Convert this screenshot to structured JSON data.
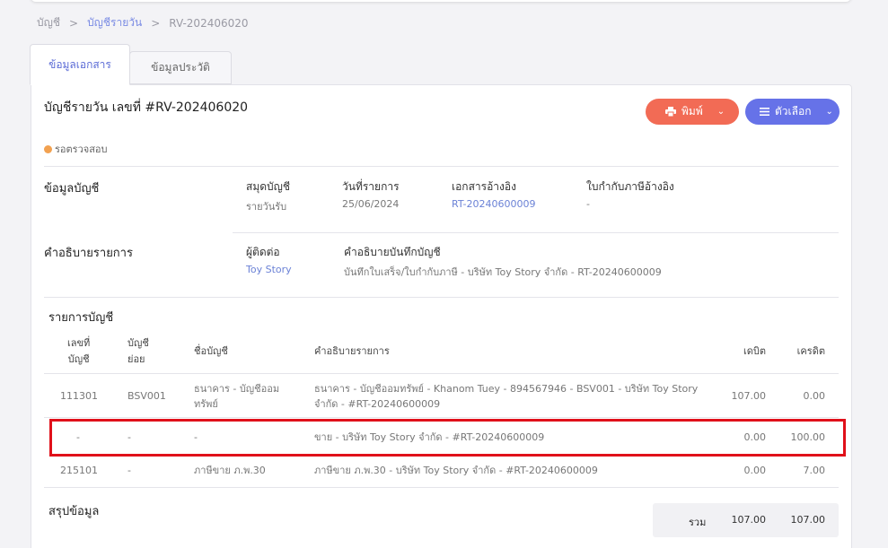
{
  "breadcrumb": {
    "item1": "บัญชี",
    "sep": ">",
    "item2": "บัญชีรายวัน",
    "item3": "RV-202406020"
  },
  "tabs": {
    "doc_info": "ข้อมูลเอกสาร",
    "history": "ข้อมูลประวัติ"
  },
  "doc": {
    "title": "บัญชีรายวัน เลขที่ #RV-202406020",
    "status": "รอตรวจสอบ",
    "status_color": "#f2a150"
  },
  "buttons": {
    "print": "พิมพ์",
    "options": "ตัวเลือก",
    "print_color": "#f26b55",
    "options_color": "#6672e8"
  },
  "account_info": {
    "label": "ข้อมูลบัญชี",
    "book_k": "สมุดบัญชี",
    "book_v": "รายวันรับ",
    "date_k": "วันที่รายการ",
    "date_v": "25/06/2024",
    "ref_k": "เอกสารอ้างอิง",
    "ref_v": "RT-20240600009",
    "tax_k": "ใบกำกับภาษีอ้างอิง",
    "tax_v": "-"
  },
  "description": {
    "label": "คำอธิบายรายการ",
    "contact_k": "ผู้ติดต่อ",
    "contact_v": "Toy Story",
    "note_k": "คำอธิบายบันทึกบัญชี",
    "note_v": "บันทึกใบเสร็จ/ใบกำกับภาษี - บริษัท Toy Story จำกัด - RT-20240600009"
  },
  "entries": {
    "title": "รายการบัญชี",
    "headers": {
      "no_1": "เลขที่",
      "no_2": "บัญชี",
      "sub_1": "บัญชี",
      "sub_2": "ย่อย",
      "name": "ชื่อบัญชี",
      "desc": "คำอธิบายรายการ",
      "debit": "เดบิต",
      "credit": "เครดิต"
    },
    "rows": [
      {
        "no": "111301",
        "sub": "BSV001",
        "name_1": "ธนาคาร - บัญชีออม",
        "name_2": "ทรัพย์",
        "desc_1": "ธนาคาร - บัญชีออมทรัพย์ - Khanom Tuey - 894567946 - BSV001 - บริษัท Toy Story",
        "desc_2": "จำกัด - #RT-20240600009",
        "debit": "107.00",
        "credit": "0.00"
      },
      {
        "no": "-",
        "sub": "-",
        "name_1": "-",
        "name_2": "",
        "desc_1": "ขาย - บริษัท Toy Story จำกัด - #RT-20240600009",
        "desc_2": "",
        "debit": "0.00",
        "credit": "100.00"
      },
      {
        "no": "215101",
        "sub": "-",
        "name_1": "ภาษีขาย ภ.พ.30",
        "name_2": "",
        "desc_1": "ภาษีขาย ภ.พ.30 - บริษัท Toy Story จำกัด - #RT-20240600009",
        "desc_2": "",
        "debit": "0.00",
        "credit": "7.00"
      }
    ]
  },
  "summary": {
    "title": "สรุปข้อมูล",
    "total_label": "รวม",
    "debit": "107.00",
    "credit": "107.00"
  },
  "highlight_color": "#e0101a"
}
